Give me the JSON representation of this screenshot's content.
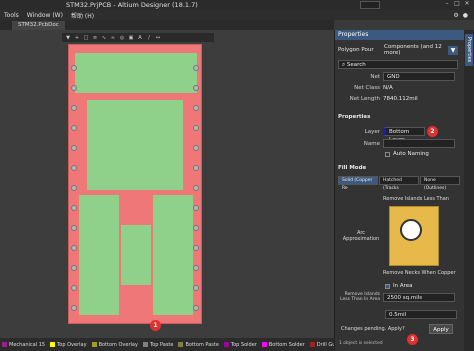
{
  "window": {
    "title": "STM32.PrjPCB - Altium Designer (18.1.7)"
  },
  "menu": {
    "items": [
      "Tools",
      "Window (W)",
      "帮助 (H)"
    ]
  },
  "tab": {
    "label": "STM32.PcbDoc"
  },
  "panel": {
    "header": "Properties",
    "type_label": "Polygon Pour",
    "components_label": "Components (and 12 more)",
    "search_placeholder": "Search",
    "net": {
      "label": "Net",
      "value": "GND"
    },
    "net_class": {
      "label": "Net Class",
      "value": "N/A"
    },
    "net_length": {
      "label": "Net Length",
      "value": "7840.112mil"
    },
    "properties_section": "Properties",
    "layer": {
      "label": "Layer",
      "value": "Bottom Layer"
    },
    "name": {
      "label": "Name",
      "value": ""
    },
    "auto_naming": "Auto Naming",
    "fill_mode_section": "Fill Mode",
    "fill_modes": [
      "Solid (Copper Re",
      "Hatched (Tracks",
      "None (Outlines)"
    ],
    "remove_islands_label": "Remove Islands Less Than",
    "arc_approx_label": "Arc Approximation",
    "remove_necks_label": "Remove Necks When Copper",
    "in_area_label": "In Area",
    "remove_islands_less_label": "Remove Islands Less Than In Area",
    "remove_islands_value": "2500 sq.mils",
    "arc_approx_value": "0.5mil",
    "changes_pending": "Changes pending. Apply?",
    "apply_button": "Apply",
    "status_text": "1 object is selected"
  },
  "markers": {
    "board_marker": "1",
    "layer_marker": "2",
    "apply_marker": "3"
  },
  "layers": [
    {
      "name": "Mechanical 15",
      "color": "#9b1e8c"
    },
    {
      "name": "Top Overlay",
      "color": "#ffff00"
    },
    {
      "name": "Bottom Overlay",
      "color": "#a0a020"
    },
    {
      "name": "Top Paste",
      "color": "#808080"
    },
    {
      "name": "Bottom Paste",
      "color": "#808040"
    },
    {
      "name": "Top Solder",
      "color": "#a000a0"
    },
    {
      "name": "Bottom Solder",
      "color": "#ff00ff"
    },
    {
      "name": "Drill Guide",
      "color": "#a02020"
    }
  ],
  "sidebar": {
    "tab_label": "Properties"
  },
  "colors": {
    "accent": "#3c5a80",
    "board_copper": "#8fd08a",
    "board_bg": "#f07777",
    "marker": "#e03030"
  }
}
